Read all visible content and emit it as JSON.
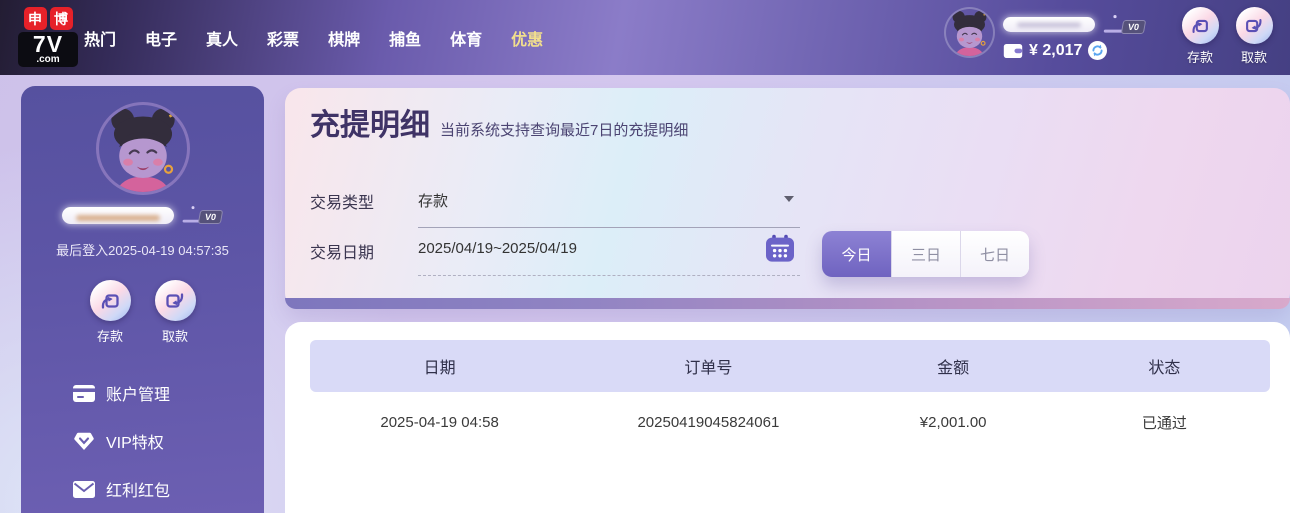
{
  "navbar": {
    "logo": {
      "tile1": "申",
      "tile2": "博",
      "brand": "7V",
      "suffix": ".com"
    },
    "menu": [
      {
        "label": "热门",
        "active": false
      },
      {
        "label": "电子",
        "active": false
      },
      {
        "label": "真人",
        "active": false
      },
      {
        "label": "彩票",
        "active": false
      },
      {
        "label": "棋牌",
        "active": false
      },
      {
        "label": "捕鱼",
        "active": false
      },
      {
        "label": "体育",
        "active": false
      },
      {
        "label": "优惠",
        "active": true
      }
    ],
    "user": {
      "vip_level": "V0",
      "balance": "¥ 2,017"
    },
    "deposit_label": "存款",
    "withdraw_label": "取款"
  },
  "sidebar": {
    "vip_level": "V0",
    "last_login": "最后登入2025-04-19 04:57:35",
    "quick": [
      {
        "label": "存款"
      },
      {
        "label": "取款"
      }
    ],
    "menu": [
      {
        "label": "账户管理"
      },
      {
        "label": "VIP特权"
      },
      {
        "label": "红利红包"
      }
    ]
  },
  "main": {
    "title": "充提明细",
    "subtitle": "当前系统支持查询最近7日的充提明细",
    "filters": {
      "type_label": "交易类型",
      "type_value": "存款",
      "date_label": "交易日期",
      "date_value": "2025/04/19~2025/04/19",
      "ranges": [
        {
          "label": "今日",
          "active": true
        },
        {
          "label": "三日",
          "active": false
        },
        {
          "label": "七日",
          "active": false
        }
      ]
    },
    "table": {
      "headers": [
        "日期",
        "订单号",
        "金额",
        "状态"
      ],
      "rows": [
        [
          "2025-04-19 04:58",
          "20250419045824061",
          "¥2,001.00",
          "已通过"
        ]
      ]
    }
  },
  "colors": {
    "accent_purple": "#6f63c0",
    "active_menu_yellow": "#f2df8d",
    "brand_red": "#e62129",
    "table_header_bg": "#d9daf7",
    "sidebar_purple": "#5d55a6"
  }
}
